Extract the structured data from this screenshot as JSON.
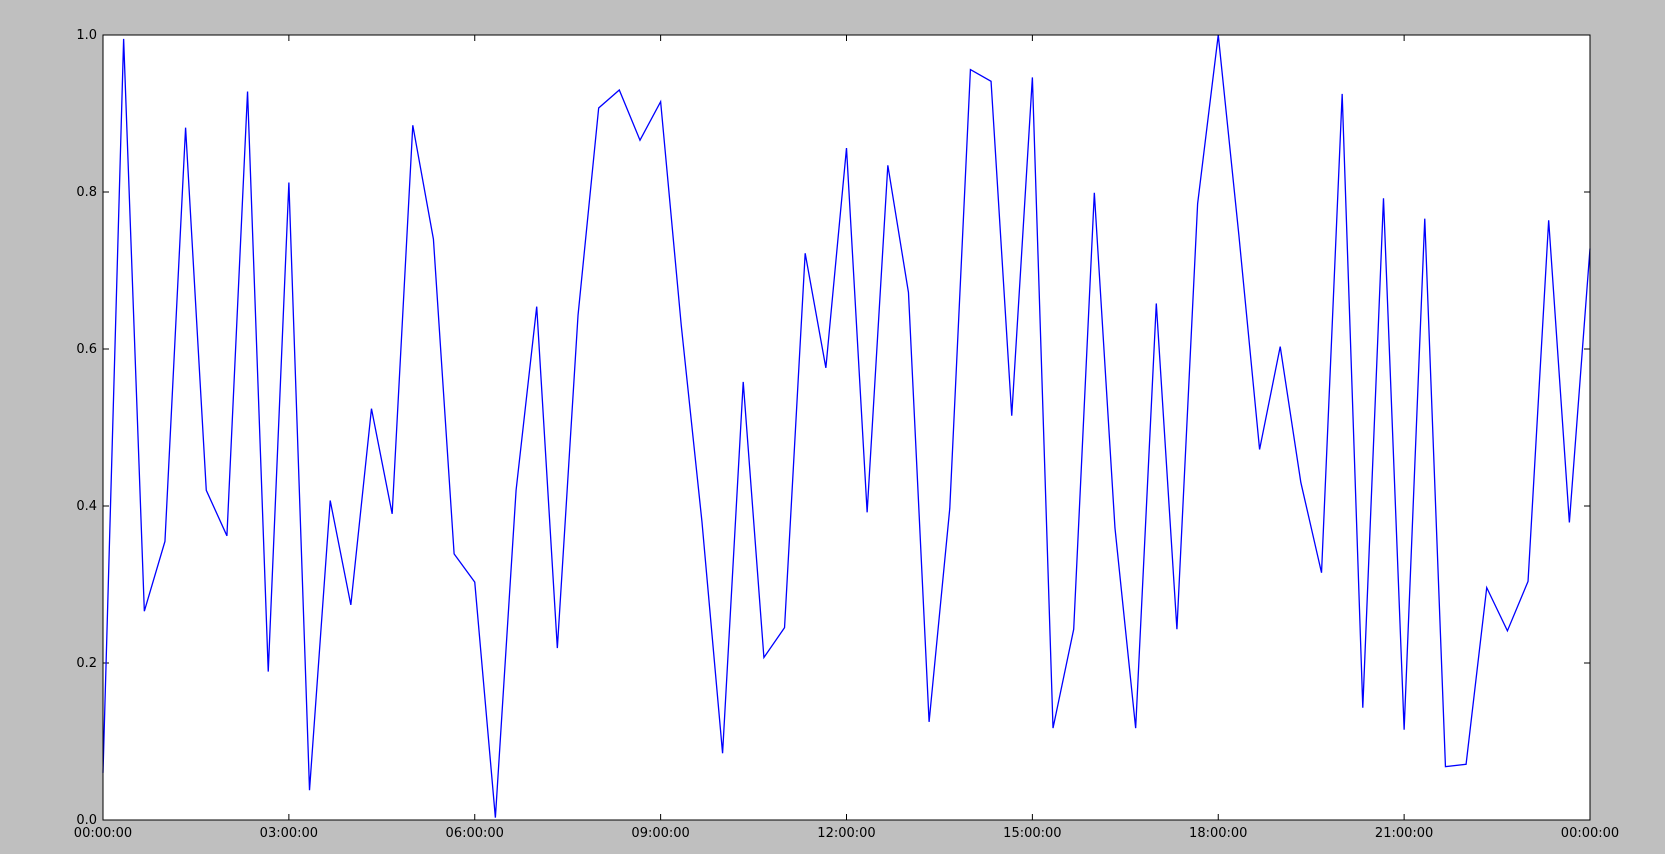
{
  "chart_data": {
    "type": "line",
    "title": "",
    "xlabel": "",
    "ylabel": "",
    "grid": false,
    "xlim": [
      0,
      24
    ],
    "ylim": [
      0.0,
      1.0
    ],
    "x_tick_labels": [
      "00:00:00",
      "03:00:00",
      "06:00:00",
      "09:00:00",
      "12:00:00",
      "15:00:00",
      "18:00:00",
      "21:00:00",
      "00:00:00"
    ],
    "y_tick_labels": [
      "0.0",
      "0.2",
      "0.4",
      "0.6",
      "0.8",
      "1.0"
    ],
    "series": [
      {
        "color": "#0000ff",
        "x_hours": [
          0.0,
          0.333,
          0.667,
          1.0,
          1.333,
          1.667,
          2.0,
          2.333,
          2.667,
          3.0,
          3.333,
          3.667,
          4.0,
          4.333,
          4.667,
          5.0,
          5.333,
          5.667,
          6.0,
          6.333,
          6.667,
          7.0,
          7.333,
          7.667,
          8.0,
          8.333,
          8.667,
          9.0,
          9.333,
          9.667,
          10.0,
          10.333,
          10.667,
          11.0,
          11.333,
          11.667,
          12.0,
          12.333,
          12.667,
          13.0,
          13.333,
          13.667,
          14.0,
          14.333,
          14.667,
          15.0,
          15.333,
          15.667,
          16.0,
          16.333,
          16.667,
          17.0,
          17.333,
          17.667,
          18.0,
          18.333,
          18.667,
          19.0,
          19.333,
          19.667,
          20.0,
          20.333,
          20.667,
          21.0,
          21.333,
          21.667,
          22.0,
          22.333,
          22.667,
          23.0,
          23.333,
          23.667,
          24.0
        ],
        "values": [
          0.06,
          0.995,
          0.266,
          0.355,
          0.882,
          0.42,
          0.362,
          0.928,
          0.189,
          0.812,
          0.038,
          0.407,
          0.274,
          0.524,
          0.39,
          0.885,
          0.74,
          0.339,
          0.303,
          0.003,
          0.42,
          0.654,
          0.219,
          0.643,
          0.907,
          0.93,
          0.866,
          0.915,
          0.63,
          0.38,
          0.085,
          0.558,
          0.207,
          0.245,
          0.722,
          0.576,
          0.856,
          0.392,
          0.834,
          0.672,
          0.125,
          0.397,
          0.956,
          0.941,
          0.515,
          0.946,
          0.117,
          0.243,
          0.799,
          0.372,
          0.117,
          0.658,
          0.243,
          0.785,
          1.0,
          0.745,
          0.472,
          0.603,
          0.43,
          0.315,
          0.925,
          0.143,
          0.792,
          0.115,
          0.766,
          0.068,
          0.071,
          0.296,
          0.241,
          0.304,
          0.764,
          0.379,
          0.728
        ]
      }
    ]
  }
}
